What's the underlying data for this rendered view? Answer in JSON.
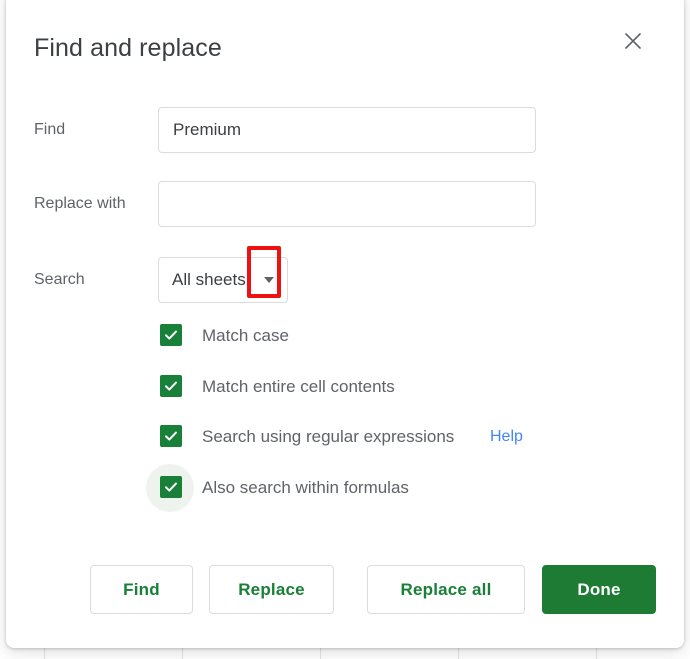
{
  "dialog": {
    "title": "Find and replace",
    "close_icon": "close-icon"
  },
  "fields": [
    {
      "label": "Find",
      "value": "Premium",
      "placeholder": ""
    },
    {
      "label": "Replace with",
      "value": "",
      "placeholder": ""
    }
  ],
  "search": {
    "label": "Search",
    "selected": "All sheets",
    "arrow_icon": "chevron-down-icon",
    "options": [
      "All sheets"
    ]
  },
  "annotation": {
    "color": "#ee1111",
    "target": "search-dropdown-arrow"
  },
  "checkboxes": [
    {
      "label": "Match case",
      "checked": true,
      "link": null
    },
    {
      "label": "Match entire cell contents",
      "checked": true,
      "link": null
    },
    {
      "label": "Search using regular expressions",
      "checked": true,
      "link": "Help"
    },
    {
      "label": "Also search within formulas",
      "checked": true,
      "link": null
    }
  ],
  "buttons": {
    "find": "Find",
    "replace": "Replace",
    "replace_all": "Replace all",
    "done": "Done"
  },
  "colors": {
    "accent_green": "#188038",
    "done_green": "#1e7b34",
    "link_blue": "#4285f4",
    "annotation_red": "#ee1111",
    "text_gray": "#5f6368"
  }
}
